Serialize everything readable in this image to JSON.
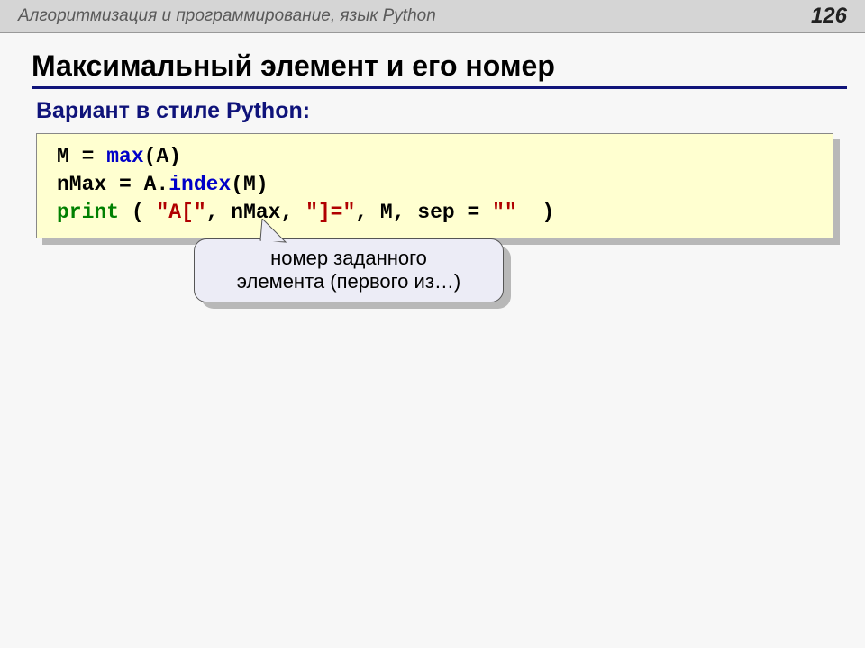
{
  "header": {
    "course": "Алгоритмизация и программирование, язык Python",
    "page": "126"
  },
  "title": "Максимальный элемент и его номер",
  "subtitle": "Вариант в стиле Python:",
  "code": {
    "l1a": "M = ",
    "l1b": "max",
    "l1c": "(A)",
    "l2a": "nMax = A.",
    "l2b": "index",
    "l2c": "(M)",
    "l3a": "print",
    "l3b": " ( ",
    "l3c": "\"A[\"",
    "l3d": ", nMax, ",
    "l3e": "\"]=\"",
    "l3f": ", M, sep = ",
    "l3g": "\"\"",
    "l3h": "  )"
  },
  "callout": {
    "line1": "номер заданного",
    "line2": "элемента (первого из…)"
  }
}
